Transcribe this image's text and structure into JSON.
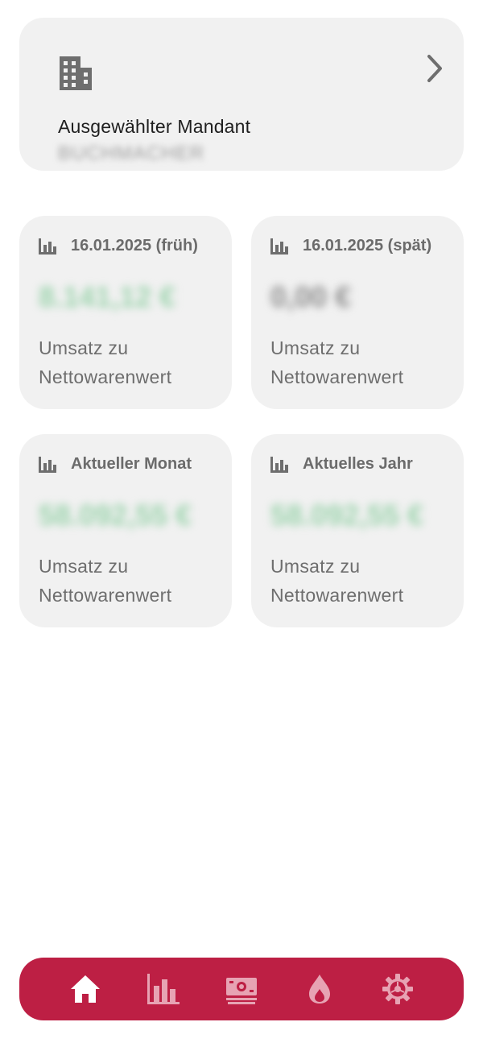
{
  "tenant": {
    "label": "Ausgewählter Mandant",
    "value": "BUCHMACHER"
  },
  "metrics": [
    {
      "title": "16.01.2025 (früh)",
      "value": "8.141,12 €",
      "desc": "Umsatz zu Nettowarenwert"
    },
    {
      "title": "16.01.2025 (spät)",
      "value": "0,00 €",
      "desc": "Umsatz zu Nettowarenwert"
    },
    {
      "title": "Aktueller Monat",
      "value": "58.092,55 €",
      "desc": "Umsatz zu Nettowarenwert"
    },
    {
      "title": "Aktuelles Jahr",
      "value": "58.092,55 €",
      "desc": "Umsatz zu Nettowarenwert"
    }
  ],
  "colors": {
    "brand": "#bd1f44",
    "card": "#f1f1f1",
    "value_positive": "#9bd3ac"
  },
  "nav": {
    "items": [
      {
        "icon": "home-icon",
        "active": true
      },
      {
        "icon": "bar-chart-icon",
        "active": false
      },
      {
        "icon": "money-icon",
        "active": false
      },
      {
        "icon": "flame-icon",
        "active": false
      },
      {
        "icon": "settings-icon",
        "active": false
      }
    ]
  }
}
